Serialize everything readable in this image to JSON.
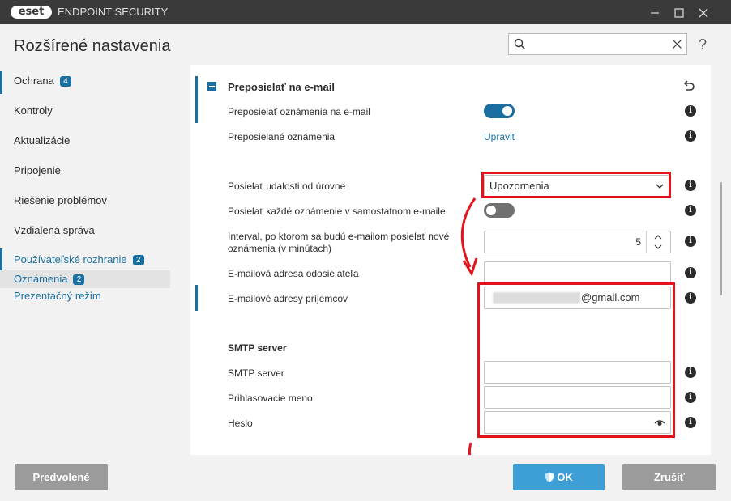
{
  "window": {
    "logo": "eset",
    "product_name": "ENDPOINT SECURITY",
    "minimize_icon": "minimize-icon",
    "maximize_icon": "maximize-icon",
    "close_icon": "close-icon"
  },
  "header": {
    "title": "Rozšírené nastavenia",
    "search": {
      "placeholder": "",
      "value": ""
    },
    "help": "?"
  },
  "sidebar": {
    "items": [
      {
        "label": "Ochrana",
        "badge": "4"
      },
      {
        "label": "Kontroly"
      },
      {
        "label": "Aktualizácie"
      },
      {
        "label": "Pripojenie"
      },
      {
        "label": "Riešenie problémov"
      },
      {
        "label": "Vzdialená správa"
      }
    ],
    "subitems": [
      {
        "label": "Používateľské rozhranie",
        "badge": "2"
      },
      {
        "label": "Oznámenia",
        "badge": "2",
        "selected": true
      },
      {
        "label": "Prezentačný režim"
      }
    ]
  },
  "section": {
    "title": "Preposielať na e-mail",
    "rows": {
      "forward": {
        "label": "Preposielať oznámenia na e-mail",
        "toggle": true
      },
      "forwarded": {
        "label": "Preposielané oznámenia",
        "link": "Upraviť"
      },
      "level": {
        "label": "Posielať udalosti od úrovne",
        "value": "Upozornenia"
      },
      "separate": {
        "label": "Posielať každé oznámenie v samostatnom e-maile",
        "toggle": false
      },
      "interval": {
        "label": "Interval, po ktorom sa budú e-mailom posielať nové oznámenia (v minútach)",
        "value": "5"
      },
      "sender": {
        "label": "E-mailová adresa odosielateľa",
        "value": ""
      },
      "recipients": {
        "label": "E-mailové adresy príjemcov",
        "value": "@gmail.com"
      },
      "smtp_heading": "SMTP server",
      "smtp_server": {
        "label": "SMTP server",
        "value": ""
      },
      "login": {
        "label": "Prihlasovacie meno",
        "value": ""
      },
      "password": {
        "label": "Heslo",
        "value": ""
      }
    }
  },
  "footer": {
    "default_label": "Predvolené",
    "ok_label": "OK",
    "cancel_label": "Zrušiť"
  },
  "colors": {
    "accent": "#1a6fa0",
    "highlight": "#e3131b",
    "ok": "#3d9fd6"
  }
}
